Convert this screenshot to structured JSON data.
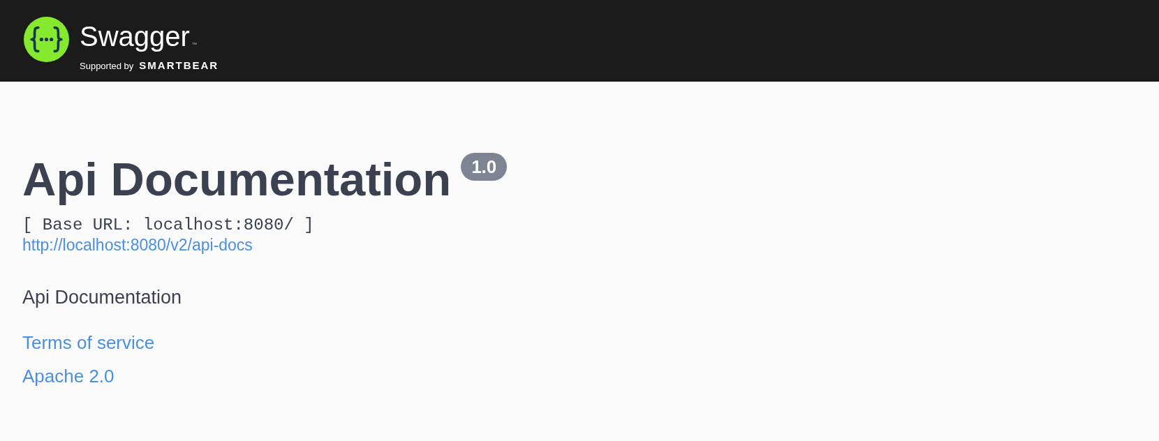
{
  "header": {
    "logo": {
      "name": "Swagger",
      "trademark": "™",
      "tagline": "Supported by",
      "sponsor": "SMARTBEAR"
    }
  },
  "info": {
    "title": "Api Documentation",
    "version": "1.0",
    "base_url": "[ Base URL: localhost:8080/ ]",
    "spec_link": "http://localhost:8080/v2/api-docs",
    "description": "Api Documentation",
    "links": [
      "Terms of service",
      "Apache 2.0"
    ]
  }
}
